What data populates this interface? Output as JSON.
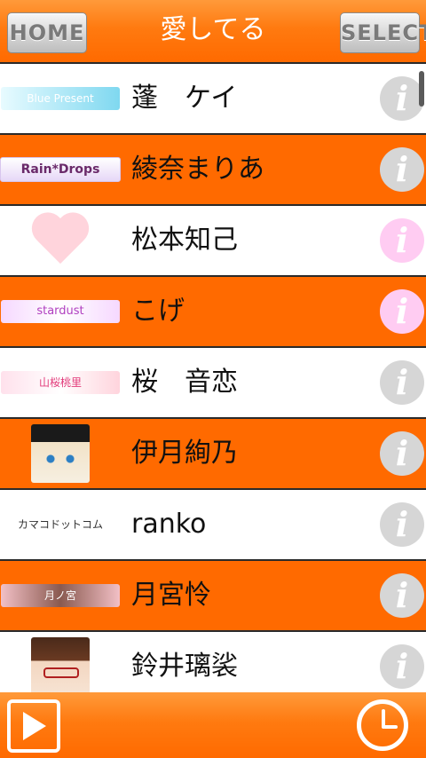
{
  "header": {
    "title": "愛してる",
    "home_label": "HOME",
    "select_label": "SELECT"
  },
  "list": [
    {
      "name": "蓬　ケイ",
      "thumb_text": "Blue Present",
      "info_icon": "info-icon"
    },
    {
      "name": "綾奈まりあ",
      "thumb_text": "Rain*Drops",
      "info_icon": "info-icon"
    },
    {
      "name": "松本知己",
      "thumb_text": "",
      "info_icon": "info-icon"
    },
    {
      "name": "こげ",
      "thumb_text": "stardust",
      "info_icon": "info-icon"
    },
    {
      "name": "桜　音恋",
      "thumb_text": "山桜桃里",
      "info_icon": "info-icon"
    },
    {
      "name": "伊月絢乃",
      "thumb_text": "",
      "info_icon": "info-icon"
    },
    {
      "name": "ranko",
      "thumb_text": "カマコドットコム",
      "info_icon": "info-icon"
    },
    {
      "name": "月宮怜",
      "thumb_text": "月ノ宮",
      "info_icon": "info-icon"
    },
    {
      "name": "鈴井璃裟",
      "thumb_text": "",
      "info_icon": "info-icon"
    }
  ],
  "footer": {
    "play_icon": "play-icon",
    "clock_icon": "clock-icon"
  },
  "colors": {
    "accent": "#ff6a00",
    "info_gray": "#d6d6d6",
    "info_pink": "#ffccf2"
  }
}
